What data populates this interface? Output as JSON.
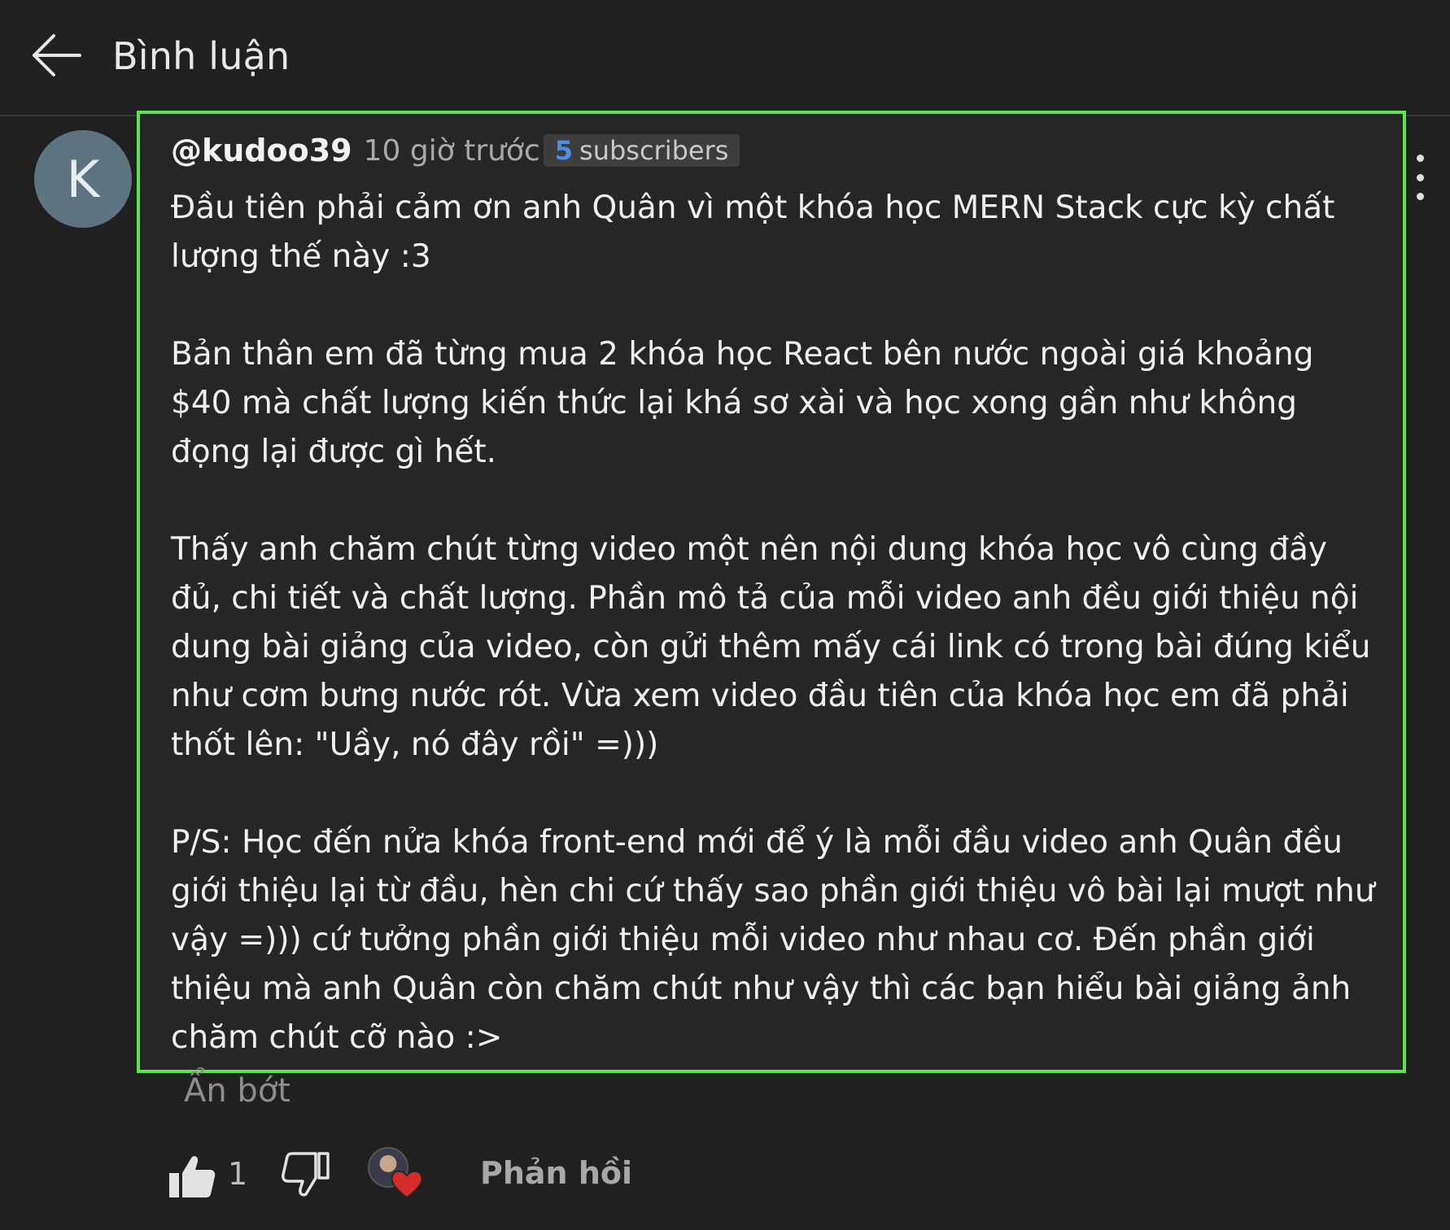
{
  "header": {
    "title": "Bình luận",
    "back_icon": "arrow-left-icon"
  },
  "comment": {
    "avatar_letter": "K",
    "avatar_color": "#5d7480",
    "author": "@kudoo39",
    "timestamp": "10 giờ trước",
    "subscriber_count": "5",
    "subscriber_label": "subscribers",
    "paragraphs": [
      "Đầu tiên phải cảm ơn anh Quân vì một khóa học MERN Stack cực kỳ chất lượng thế này :3",
      "Bản thân em đã từng mua 2 khóa học React bên nước ngoài giá khoảng $40 mà chất lượng kiến thức lại khá sơ xài và học xong gần như không đọng lại được gì hết.",
      "Thấy anh chăm chút từng video một nên nội dung khóa học vô cùng đầy đủ, chi tiết và chất lượng. Phần mô tả của mỗi video anh đều giới thiệu nội dung bài giảng của video, còn gửi thêm mấy cái link có trong bài đúng kiểu như cơm bưng nước rót. Vừa xem video đầu tiên của khóa học em đã phải thốt lên: \"Uầy, nó đây rồi\" =)))",
      "P/S: Học đến nửa khóa front-end mới để ý là mỗi đầu video anh Quân đều giới thiệu lại từ đầu, hèn chi cứ thấy sao phần giới thiệu vô bài lại mượt như vậy =))) cứ tưởng phần giới thiệu mỗi video như nhau cơ. Đến phần giới thiệu mà anh Quân còn chăm chút như vậy thì các bạn hiểu bài giảng ảnh chăm chút cỡ nào :>"
    ],
    "collapse_label": "Ẩn bớt",
    "like_count": "1",
    "reply_label": "Phản hồi",
    "highlight_color": "#59e54b",
    "heart_color": "#d42b2b"
  }
}
